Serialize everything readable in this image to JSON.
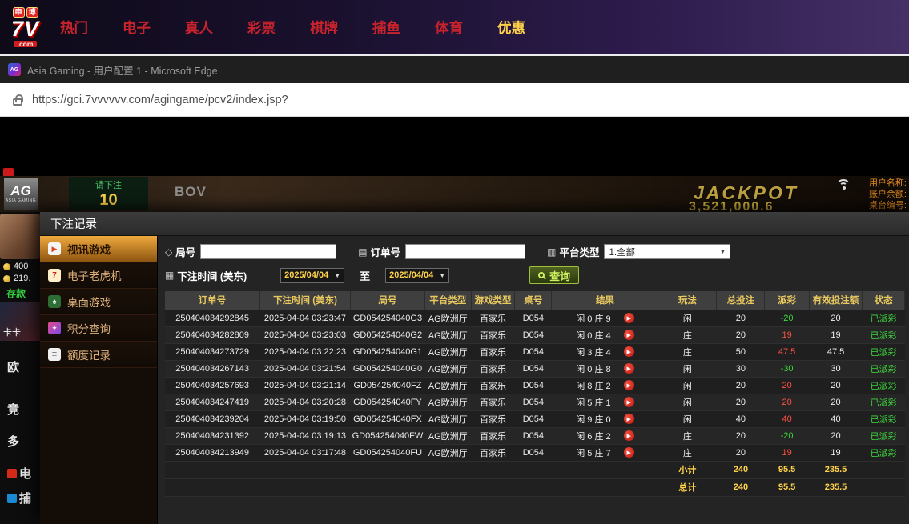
{
  "topnav": {
    "logo": {
      "badge_left": "申",
      "badge_right": "博",
      "main": "7V",
      "sub": ".com"
    },
    "items": [
      {
        "label": "热门",
        "highlight": false
      },
      {
        "label": "电子",
        "highlight": false
      },
      {
        "label": "真人",
        "highlight": false
      },
      {
        "label": "彩票",
        "highlight": false
      },
      {
        "label": "棋牌",
        "highlight": false
      },
      {
        "label": "捕鱼",
        "highlight": false
      },
      {
        "label": "体育",
        "highlight": false
      },
      {
        "label": "优惠",
        "highlight": true
      }
    ]
  },
  "browser": {
    "window_title": "Asia Gaming - 用户配置 1 - Microsoft Edge",
    "url": "https://gci.7vvvvvv.com/agingame/pcv2/index.jsp?"
  },
  "game": {
    "ag_logo": "AG",
    "ag_sub": "ASIA GAMING",
    "bet_prompt": "请下注",
    "countdown": "10",
    "bov": "BOV",
    "jackpot_label": "JACKPOT",
    "jackpot_value": "3,521,000.6",
    "info": {
      "user_label": "用户名称:",
      "balance_label": "账户余额:",
      "table_label": "桌台编号:"
    },
    "left_strip": {
      "balance_gold": "400",
      "balance_cash": "219.",
      "deposit": "存款",
      "banner_text": "卡卡",
      "labels": [
        {
          "label": "欧",
          "icon": null
        },
        {
          "label": "竞",
          "icon": null
        },
        {
          "label": "多",
          "icon": null
        },
        {
          "label": "电",
          "icon": "red",
          "icon_name": "electronic-games-icon"
        },
        {
          "label": "捕",
          "icon": "teal",
          "icon_name": "fishing-games-icon"
        }
      ]
    }
  },
  "modal": {
    "title": "下注记录",
    "menu": [
      {
        "label": "视讯游戏",
        "icon": "video-game-icon",
        "glyph": "▶",
        "active": true
      },
      {
        "label": "电子老虎机",
        "icon": "slot-machine-icon",
        "glyph": "7",
        "active": false
      },
      {
        "label": "桌面游戏",
        "icon": "table-game-icon",
        "glyph": "♠",
        "active": false
      },
      {
        "label": "积分查询",
        "icon": "points-query-icon",
        "glyph": "✦",
        "active": false
      },
      {
        "label": "额度记录",
        "icon": "quota-record-icon",
        "glyph": "≡",
        "active": false
      }
    ],
    "filters": {
      "round_label": "局号",
      "order_label": "订单号",
      "platform_label": "平台类型",
      "platform_value": "1.全部",
      "time_label": "下注时间 (美东)",
      "date_from": "2025/04/04",
      "to_label": "至",
      "date_to": "2025/04/04",
      "search_label": "查询"
    },
    "table": {
      "headers": [
        "订单号",
        "下注时间 (美东)",
        "局号",
        "平台类型",
        "游戏类型",
        "桌号",
        "结果",
        "玩法",
        "总投注",
        "派彩",
        "有效投注额",
        "状态"
      ],
      "rows": [
        {
          "order": "250404034292845",
          "time": "2025-04-04 03:23:47",
          "round": "GD054254040G3",
          "platform": "AG欧洲厅",
          "game": "百家乐",
          "table": "D054",
          "result": "闲 0 庄 9",
          "play": "闲",
          "total": "20",
          "payout": "-20",
          "valid": "20",
          "status": "已派彩"
        },
        {
          "order": "250404034282809",
          "time": "2025-04-04 03:23:03",
          "round": "GD054254040G2",
          "platform": "AG欧洲厅",
          "game": "百家乐",
          "table": "D054",
          "result": "闲 0 庄 4",
          "play": "庄",
          "total": "20",
          "payout": "19",
          "valid": "19",
          "status": "已派彩"
        },
        {
          "order": "250404034273729",
          "time": "2025-04-04 03:22:23",
          "round": "GD054254040G1",
          "platform": "AG欧洲厅",
          "game": "百家乐",
          "table": "D054",
          "result": "闲 3 庄 4",
          "play": "庄",
          "total": "50",
          "payout": "47.5",
          "valid": "47.5",
          "status": "已派彩"
        },
        {
          "order": "250404034267143",
          "time": "2025-04-04 03:21:54",
          "round": "GD054254040G0",
          "platform": "AG欧洲厅",
          "game": "百家乐",
          "table": "D054",
          "result": "闲 0 庄 8",
          "play": "闲",
          "total": "30",
          "payout": "-30",
          "valid": "30",
          "status": "已派彩"
        },
        {
          "order": "250404034257693",
          "time": "2025-04-04 03:21:14",
          "round": "GD054254040FZ",
          "platform": "AG欧洲厅",
          "game": "百家乐",
          "table": "D054",
          "result": "闲 8 庄 2",
          "play": "闲",
          "total": "20",
          "payout": "20",
          "valid": "20",
          "status": "已派彩"
        },
        {
          "order": "250404034247419",
          "time": "2025-04-04 03:20:28",
          "round": "GD054254040FY",
          "platform": "AG欧洲厅",
          "game": "百家乐",
          "table": "D054",
          "result": "闲 5 庄 1",
          "play": "闲",
          "total": "20",
          "payout": "20",
          "valid": "20",
          "status": "已派彩"
        },
        {
          "order": "250404034239204",
          "time": "2025-04-04 03:19:50",
          "round": "GD054254040FX",
          "platform": "AG欧洲厅",
          "game": "百家乐",
          "table": "D054",
          "result": "闲 9 庄 0",
          "play": "闲",
          "total": "40",
          "payout": "40",
          "valid": "40",
          "status": "已派彩"
        },
        {
          "order": "250404034231392",
          "time": "2025-04-04 03:19:13",
          "round": "GD054254040FW",
          "platform": "AG欧洲厅",
          "game": "百家乐",
          "table": "D054",
          "result": "闲 6 庄 2",
          "play": "庄",
          "total": "20",
          "payout": "-20",
          "valid": "20",
          "status": "已派彩"
        },
        {
          "order": "250404034213949",
          "time": "2025-04-04 03:17:48",
          "round": "GD054254040FU",
          "platform": "AG欧洲厅",
          "game": "百家乐",
          "table": "D054",
          "result": "闲 5 庄 7",
          "play": "庄",
          "total": "20",
          "payout": "19",
          "valid": "19",
          "status": "已派彩"
        }
      ],
      "subtotal": {
        "label": "小计",
        "total": "240",
        "payout": "95.5",
        "valid": "235.5"
      },
      "grandtotal": {
        "label": "总计",
        "total": "240",
        "payout": "95.5",
        "valid": "235.5"
      }
    },
    "colors": {
      "payout_positive": "#ff5040",
      "payout_negative": "#3ed63e",
      "status_paid": "#3ed63e",
      "accent_yellow": "#ffd24a",
      "header_gold": "#e9c95f",
      "search_green": "#cdf05e"
    }
  },
  "icons": {
    "lock-icon": "css-shape",
    "round-tag-icon": "◇",
    "order-doc-icon": "▤",
    "platform-list-icon": "▥",
    "calendar-icon": "▦",
    "search-icon": "css-magnifier",
    "play-icon": "▶",
    "dropdown-arrow-icon": "▼",
    "wifi-icon": "css-arcs",
    "coin-icon": "css-circle"
  }
}
